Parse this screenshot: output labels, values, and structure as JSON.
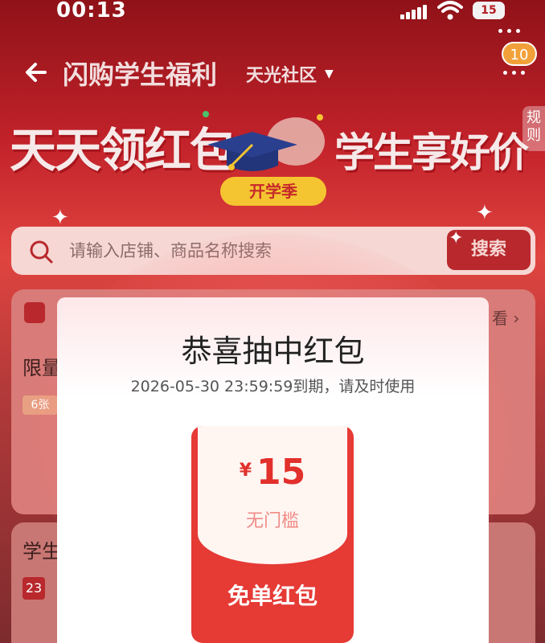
{
  "status_bar": {
    "time": "00:13",
    "battery": "15"
  },
  "header": {
    "title": "闪购学生福利",
    "community": "天光社区",
    "notification_count": "10"
  },
  "banner": {
    "left_text": "天天领红包",
    "right_text": "学生享好价",
    "season_badge": "开学季",
    "rules_label": "规则"
  },
  "search": {
    "placeholder": "请输入店铺、商品名称搜索",
    "button_label": "搜索"
  },
  "background": {
    "section1_label": "限量",
    "coupon_count": "6张",
    "view_more": "看 ›",
    "section2_label": "学生",
    "countdown": "23"
  },
  "modal": {
    "title": "恭喜抽中红包",
    "expiry": "2026-05-30 23:59:59到期，请及时使用",
    "red_packet": {
      "currency": "¥",
      "amount": "15",
      "threshold": "无门槛",
      "label": "免单红包"
    }
  },
  "colors": {
    "brand_red": "#e63a35",
    "header_red": "#b51d22",
    "badge_orange": "#f2a13a",
    "season_yellow": "#f5c531"
  }
}
